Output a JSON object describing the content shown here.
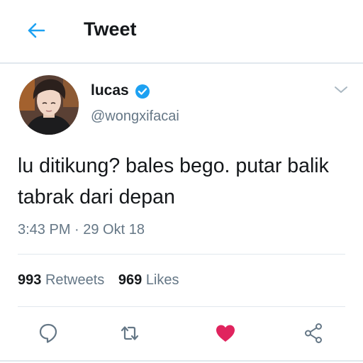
{
  "header": {
    "title": "Tweet",
    "back_icon": "arrow-left-icon",
    "accent": "#1da1f2"
  },
  "tweet": {
    "author": {
      "display_name": "lucas",
      "handle": "@wongxifacai",
      "verified": true,
      "verified_color": "#1da1f2"
    },
    "text": "lu ditikung? bales bego. putar balik tabrak dari depan",
    "timestamp": "3:43 PM · 29 Okt 18",
    "stats": {
      "retweets_count": "993",
      "retweets_label": "Retweets",
      "likes_count": "969",
      "likes_label": "Likes"
    },
    "actions": [
      {
        "name": "reply",
        "icon": "comment-icon"
      },
      {
        "name": "retweet",
        "icon": "retweet-icon"
      },
      {
        "name": "like",
        "icon": "heart-icon",
        "active": true,
        "color": "#e0245e"
      },
      {
        "name": "share",
        "icon": "share-icon"
      }
    ]
  },
  "colors": {
    "text_primary": "#14171a",
    "text_secondary": "#657786",
    "divider": "#e1e8ed"
  }
}
